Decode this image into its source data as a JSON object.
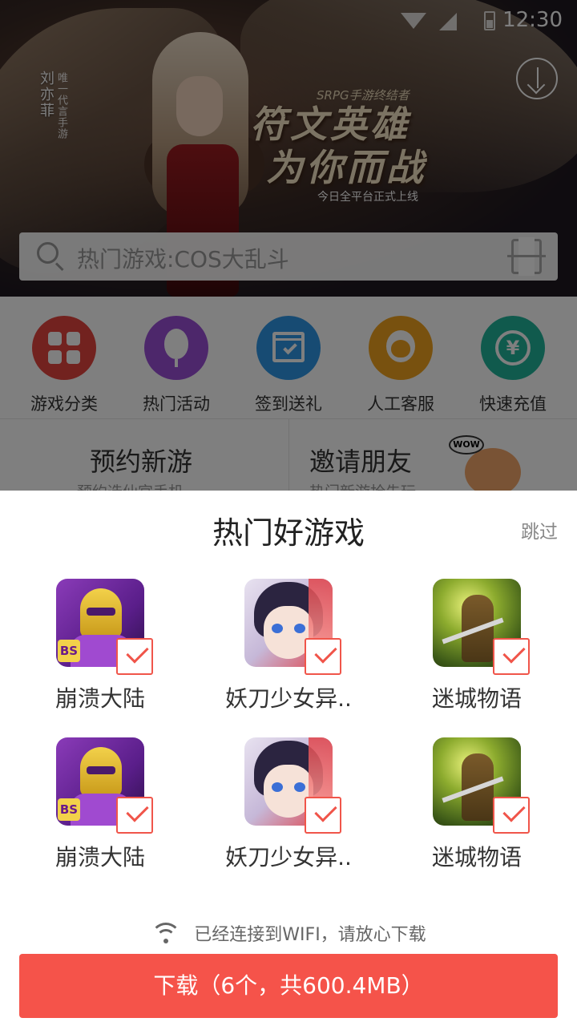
{
  "status_bar": {
    "time": "12:30"
  },
  "banner": {
    "caption_name": "刘亦菲",
    "caption_sub": "唯一代言手游",
    "ad_subtitle": "SRPG手游终结者",
    "ad_title_line1": "符文英雄",
    "ad_title_line2": "为你而战",
    "ad_tagline": "今日全平台正式上线"
  },
  "search": {
    "placeholder": "热门游戏:COS大乱斗"
  },
  "quick_entries": [
    {
      "label": "游戏分类",
      "icon": "grid-icon",
      "color": "#e5453f"
    },
    {
      "label": "热门活动",
      "icon": "balloon-icon",
      "color": "#9a4fd6"
    },
    {
      "label": "签到送礼",
      "icon": "calendar-check-icon",
      "color": "#2f97e6"
    },
    {
      "label": "人工客服",
      "icon": "customer-service-icon",
      "color": "#f0a21e"
    },
    {
      "label": "快速充值",
      "icon": "yen-icon",
      "color": "#20b49a"
    }
  ],
  "promo": {
    "left_title": "预约新游",
    "left_sub": "预约选仙宫手机",
    "right_title": "邀请朋友",
    "right_sub": "热门新游抢先玩",
    "sticker_text": "WOW"
  },
  "sheet": {
    "title": "热门好游戏",
    "skip_label": "跳过",
    "games": [
      {
        "name": "崩溃大陆",
        "art": "robot",
        "checked": true
      },
      {
        "name": "妖刀少女异..",
        "art": "anime",
        "checked": true
      },
      {
        "name": "迷城物语",
        "art": "knight",
        "checked": true
      },
      {
        "name": "崩溃大陆",
        "art": "robot",
        "checked": true
      },
      {
        "name": "妖刀少女异..",
        "art": "anime",
        "checked": true
      },
      {
        "name": "迷城物语",
        "art": "knight",
        "checked": true
      }
    ],
    "wifi_notice": "已经连接到WIFI，请放心下载",
    "download_button": "下载（6个，共600.4MB）"
  },
  "colors": {
    "accent": "#f5534a",
    "check": "#f0554a"
  }
}
